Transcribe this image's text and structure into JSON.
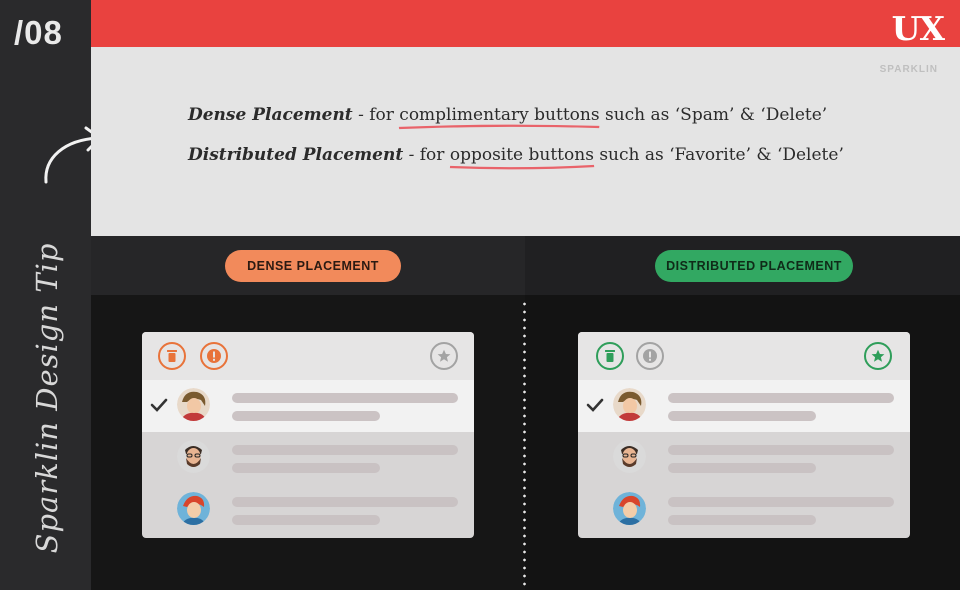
{
  "slide": {
    "number": "/08",
    "series_title": "Sparklin Design Tip"
  },
  "brand": {
    "logo": "UX",
    "small": "SPARKLIN"
  },
  "colors": {
    "accent_red": "#e9423f",
    "dense_orange": "#f28a5b",
    "distributed_green": "#32a862",
    "neutral_grey": "#a3a3a3"
  },
  "tips": [
    {
      "term": "Dense Placement",
      "sep": " - ",
      "pre": "for ",
      "underlined": "complimentary buttons",
      "post": " such as ‘Spam’ & ‘Delete’"
    },
    {
      "term": "Distributed Placement",
      "sep": " - ",
      "pre": "for ",
      "underlined": "opposite buttons",
      "post": " such as ‘Favorite’ & ‘Delete’"
    }
  ],
  "sections": {
    "dense": {
      "label": "DENSE PLACEMENT",
      "toolbar": [
        {
          "icon": "trash-icon",
          "color": "#e8733a"
        },
        {
          "icon": "spam-icon",
          "color": "#e8733a"
        },
        {
          "icon": "star-icon",
          "color": "#a3a3a3"
        }
      ]
    },
    "distributed": {
      "label": "DISTRIBUTED PLACEMENT",
      "toolbar": [
        {
          "icon": "trash-icon",
          "color": "#2f9e5a"
        },
        {
          "icon": "spam-icon",
          "color": "#a3a3a3"
        },
        {
          "icon": "star-icon",
          "color": "#2f9e5a"
        }
      ]
    }
  },
  "list_rows": [
    {
      "selected": true,
      "avatar": "avatar-woman-icon"
    },
    {
      "selected": false,
      "avatar": "avatar-bearded-man-icon"
    },
    {
      "selected": false,
      "avatar": "avatar-red-hair-icon"
    }
  ]
}
